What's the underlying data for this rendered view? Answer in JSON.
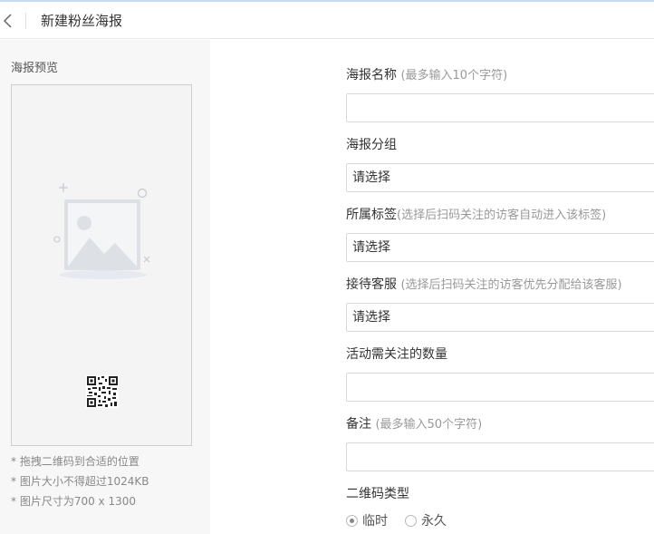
{
  "header": {
    "title": "新建粉丝海报"
  },
  "preview": {
    "title": "海报预览",
    "tips": [
      "* 拖拽二维码到合适的位置",
      "* 图片大小不得超过1024KB",
      "* 图片尺寸为700 x 1300"
    ]
  },
  "form": {
    "name": {
      "label": "海报名称",
      "hint": "(最多输入10个字符)",
      "value": ""
    },
    "group": {
      "label": "海报分组",
      "value": "请选择"
    },
    "tag": {
      "label": "所属标签",
      "hint": "(选择后扫码关注的访客自动进入该标签)",
      "value": "请选择"
    },
    "service": {
      "label": "接待客服",
      "hint": "(选择后扫码关注的访客优先分配给该客服)",
      "value": "请选择"
    },
    "follow_count": {
      "label": "活动需关注的数量",
      "value": ""
    },
    "remark": {
      "label": "备注",
      "hint": "(最多输入50个字符)",
      "value": ""
    },
    "qr_type": {
      "label": "二维码类型",
      "options": [
        {
          "label": "临时",
          "checked": true
        },
        {
          "label": "永久",
          "checked": false
        }
      ]
    }
  },
  "icons": {
    "back": "chevron-left-icon",
    "placeholder": "image-placeholder-icon",
    "qr": "qr-code-icon"
  },
  "colors": {
    "top_accent": "#c9dcef",
    "left_panel_bg": "#f7f7f7",
    "hint_text": "#999999"
  }
}
